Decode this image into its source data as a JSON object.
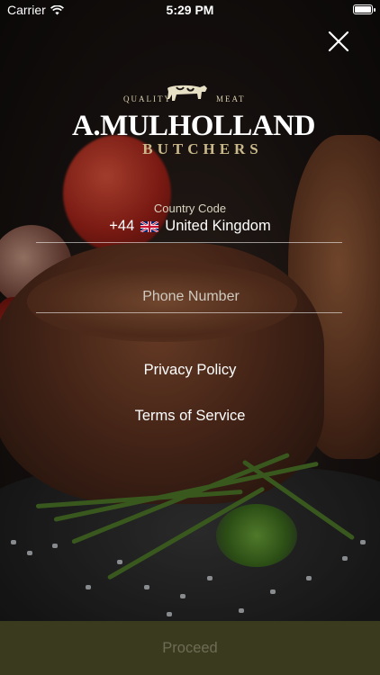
{
  "status_bar": {
    "carrier": "Carrier",
    "time": "5:29 PM"
  },
  "brand": {
    "quality": "QUALITY",
    "meat": "MEAT",
    "name": "A.MULHOLLAND",
    "subtitle": "BUTCHERS"
  },
  "country": {
    "label": "Country Code",
    "code": "+44",
    "flag": "uk-flag-icon",
    "name": "United Kingdom"
  },
  "phone": {
    "placeholder": "Phone Number",
    "value": ""
  },
  "links": {
    "privacy": "Privacy Policy",
    "terms": "Terms of Service"
  },
  "proceed": {
    "label": "Proceed"
  },
  "colors": {
    "proceed_bg": "#3a3b1e",
    "proceed_text": "#6e6c55",
    "brand_gold": "#c9b98a"
  }
}
